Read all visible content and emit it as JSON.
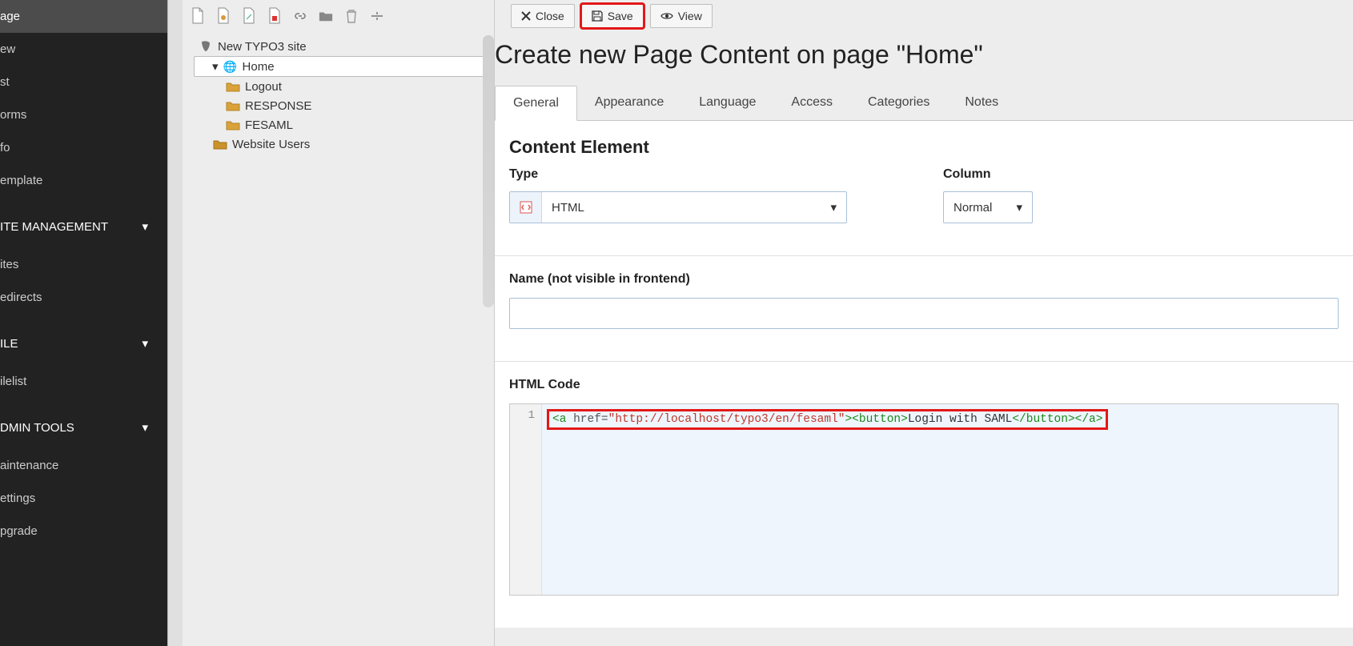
{
  "sidebar": {
    "items": [
      {
        "label": "age",
        "active": true
      },
      {
        "label": "ew"
      },
      {
        "label": "st"
      },
      {
        "label": "orms"
      },
      {
        "label": "fo"
      },
      {
        "label": "emplate"
      }
    ],
    "groups": [
      {
        "title": "ITE MANAGEMENT",
        "items": [
          {
            "label": "ites"
          },
          {
            "label": "edirects"
          }
        ]
      },
      {
        "title": "ILE",
        "items": [
          {
            "label": "ilelist"
          }
        ]
      },
      {
        "title": "DMIN TOOLS",
        "items": [
          {
            "label": "aintenance"
          },
          {
            "label": "ettings"
          },
          {
            "label": "pgrade"
          }
        ]
      }
    ]
  },
  "tree": {
    "root": "New TYPO3 site",
    "home": "Home",
    "children": [
      {
        "label": "Logout"
      },
      {
        "label": "RESPONSE"
      },
      {
        "label": "FESAML"
      },
      {
        "label": "Website Users"
      }
    ]
  },
  "actions": {
    "close": "Close",
    "save": "Save",
    "view": "View"
  },
  "page": {
    "title": "Create new Page Content on page \"Home\"",
    "tabs": [
      "General",
      "Appearance",
      "Language",
      "Access",
      "Categories",
      "Notes"
    ],
    "section_heading": "Content Element",
    "type_label": "Type",
    "type_value": "HTML",
    "column_label": "Column",
    "column_value": "Normal",
    "name_label": "Name (not visible in frontend)",
    "name_value": "",
    "code_label": "HTML Code",
    "code": {
      "line_no": "1",
      "t1": "<a ",
      "attr": "href",
      "eq": "=",
      "str": "\"http://localhost/typo3/en/fesaml\"",
      "t2": "><button>",
      "text": "Login with SAML",
      "t3": "</button></a>"
    }
  }
}
